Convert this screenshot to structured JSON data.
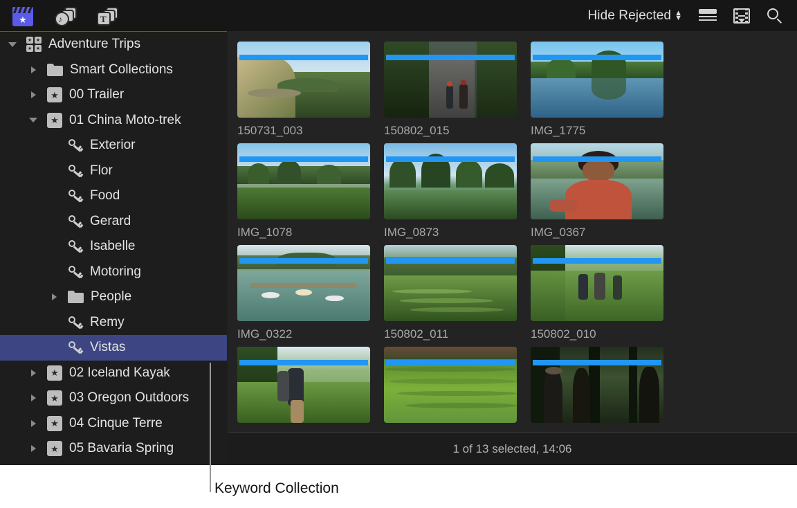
{
  "toolbar": {
    "tabs": [
      {
        "name": "libraries",
        "icon": "library-clapperboard-icon",
        "active": true
      },
      {
        "name": "photos-audio",
        "icon": "photos-audio-icon",
        "active": false
      },
      {
        "name": "titles-generators",
        "icon": "titles-generators-icon",
        "active": false
      }
    ],
    "filter_label": "Hide Rejected",
    "view_list_icon": "list-view-icon",
    "view_filmstrip_icon": "filmstrip-view-icon",
    "search_icon": "search-icon"
  },
  "sidebar": {
    "items": [
      {
        "label": "Adventure Trips",
        "icon": "library-icon",
        "twisty": "open",
        "indent": 0,
        "selected": false
      },
      {
        "label": "Smart Collections",
        "icon": "folder-icon",
        "twisty": "closed",
        "indent": 1,
        "selected": false
      },
      {
        "label": "00 Trailer",
        "icon": "event-icon",
        "twisty": "closed",
        "indent": 1,
        "selected": false
      },
      {
        "label": "01 China Moto-trek",
        "icon": "event-icon",
        "twisty": "open",
        "indent": 1,
        "selected": false
      },
      {
        "label": "Exterior",
        "icon": "keyword-icon",
        "twisty": "none",
        "indent": 2,
        "selected": false
      },
      {
        "label": "Flor",
        "icon": "keyword-icon",
        "twisty": "none",
        "indent": 2,
        "selected": false
      },
      {
        "label": "Food",
        "icon": "keyword-icon",
        "twisty": "none",
        "indent": 2,
        "selected": false
      },
      {
        "label": "Gerard",
        "icon": "keyword-icon",
        "twisty": "none",
        "indent": 2,
        "selected": false
      },
      {
        "label": "Isabelle",
        "icon": "keyword-icon",
        "twisty": "none",
        "indent": 2,
        "selected": false
      },
      {
        "label": "Motoring",
        "icon": "keyword-icon",
        "twisty": "none",
        "indent": 2,
        "selected": false
      },
      {
        "label": "People",
        "icon": "folder-icon",
        "twisty": "closed",
        "indent": 2,
        "selected": false
      },
      {
        "label": "Remy",
        "icon": "keyword-icon",
        "twisty": "none",
        "indent": 2,
        "selected": false
      },
      {
        "label": "Vistas",
        "icon": "keyword-icon",
        "twisty": "none",
        "indent": 2,
        "selected": true
      },
      {
        "label": "02 Iceland Kayak",
        "icon": "event-icon",
        "twisty": "closed",
        "indent": 1,
        "selected": false
      },
      {
        "label": "03 Oregon Outdoors",
        "icon": "event-icon",
        "twisty": "closed",
        "indent": 1,
        "selected": false
      },
      {
        "label": "04 Cinque Terre",
        "icon": "event-icon",
        "twisty": "closed",
        "indent": 1,
        "selected": false
      },
      {
        "label": "05 Bavaria Spring",
        "icon": "event-icon",
        "twisty": "closed",
        "indent": 1,
        "selected": false
      }
    ]
  },
  "browser": {
    "clips": [
      {
        "name": "150731_003",
        "scene": "cliff-overlook",
        "favorite": true
      },
      {
        "name": "150802_015",
        "scene": "motorbike-road",
        "favorite": true
      },
      {
        "name": "IMG_1775",
        "scene": "karst-reflection",
        "favorite": true
      },
      {
        "name": "IMG_1078",
        "scene": "karst-field",
        "favorite": true
      },
      {
        "name": "IMG_0873",
        "scene": "karst-river",
        "favorite": true
      },
      {
        "name": "IMG_0367",
        "scene": "portrait-man",
        "favorite": true
      },
      {
        "name": "IMG_0322",
        "scene": "river-rafts",
        "favorite": true
      },
      {
        "name": "150802_011",
        "scene": "terrace-hills",
        "favorite": true
      },
      {
        "name": "150802_010",
        "scene": "hikers-terrace",
        "favorite": true
      },
      {
        "name": "",
        "scene": "hikers-trail",
        "favorite": true
      },
      {
        "name": "",
        "scene": "rice-terrace",
        "favorite": true
      },
      {
        "name": "",
        "scene": "silhouettes",
        "favorite": true
      }
    ],
    "status": "1 of 13 selected, 14:06"
  },
  "callout": {
    "label": "Keyword Collection"
  },
  "colors": {
    "selection_blue": "#3d4682",
    "favorite_blue": "#2196f3",
    "accent_purple": "#5b5be8",
    "app_background": "#1e1e1e",
    "sidebar_background": "#1d1d1d",
    "browser_background": "#232323"
  }
}
